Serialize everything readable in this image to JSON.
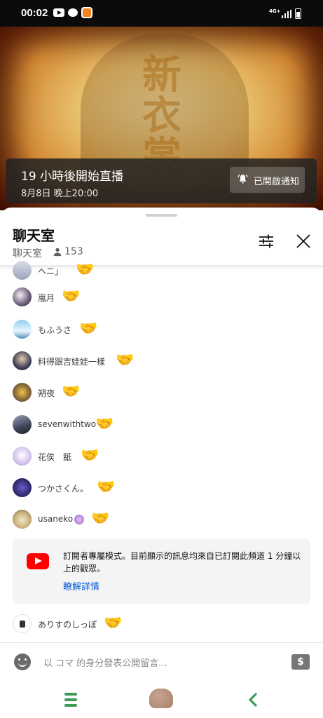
{
  "status_bar": {
    "time": "00:02",
    "network": "4G+"
  },
  "video": {
    "banner_title": "19 小時後開始直播",
    "banner_subtitle": "8月8日 晚上20:00",
    "notify_button": "已開啟通知"
  },
  "chat": {
    "title": "聊天室",
    "subtitle": "聊天室",
    "viewer_count": "153",
    "messages": [
      {
        "author": "ヘニ」",
        "emoji": "🤝"
      },
      {
        "author": "嵐月",
        "emoji": "🤝"
      },
      {
        "author": "もふうさ",
        "emoji": "🤝"
      },
      {
        "author": "料得跟吉娃娃一樣",
        "emoji": "🤝"
      },
      {
        "author": "朔夜",
        "emoji": "🤝"
      },
      {
        "author": "sevenwithtwo",
        "emoji": "🤝"
      },
      {
        "author": "花俟　舐",
        "emoji": "🤝"
      },
      {
        "author": "つかさくん。",
        "emoji": "🤝"
      },
      {
        "author": "usaneko",
        "emoji": "🤝"
      },
      {
        "author": "ありすのしっぽ",
        "emoji": "🤝"
      }
    ],
    "notice": {
      "text": "訂閱者專屬模式。目前顯示的訊息均來自已訂閱此頻道 1 分鐘以上的觀眾。",
      "link": "瞭解詳情"
    },
    "input_placeholder": "以 コマ 的身分發表公開留言...",
    "currency_button": "$"
  },
  "icons": {
    "viewer": "person-icon",
    "filter": "sliders-icon",
    "close": "close-icon",
    "notify": "bell-ringing-icon",
    "emoji": "smiley-icon",
    "currency": "currency-icon",
    "youtube": "youtube-logo-icon"
  },
  "colors": {
    "link": "#065fd4",
    "youtube_red": "#ff0000",
    "nav_accent": "#3c9a55"
  }
}
